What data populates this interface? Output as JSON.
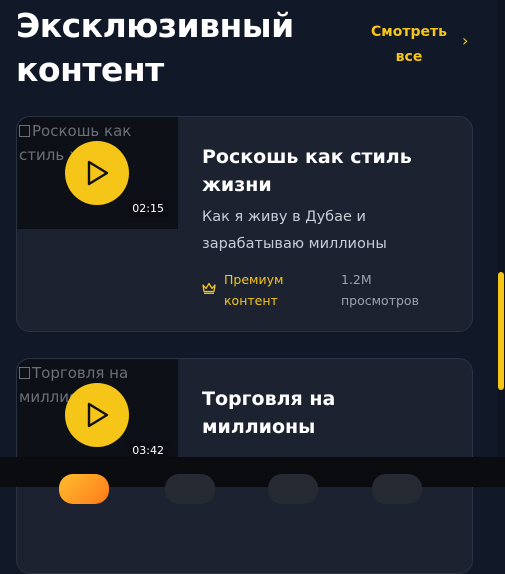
{
  "header": {
    "title": "Эксклюзивный контент",
    "see_all_label": "Смотреть все",
    "chevron_icon": "chevron-right-icon"
  },
  "cards": [
    {
      "image_alt": "Роскошь как стиль жизни",
      "duration": "02:15",
      "title": "Роскошь как стиль жизни",
      "description": "Как я живу в Дубае и зарабатываю миллионы",
      "badge": "Премиум контент",
      "views": "1.2M просмотров"
    },
    {
      "image_alt": "Торговля на миллионы",
      "duration": "03:42",
      "title": "Торговля на миллионы"
    }
  ],
  "colors": {
    "accent": "#f5c518",
    "background": "#111827",
    "card": "#1c2230"
  },
  "scrollbar": {
    "position": 0.59
  }
}
